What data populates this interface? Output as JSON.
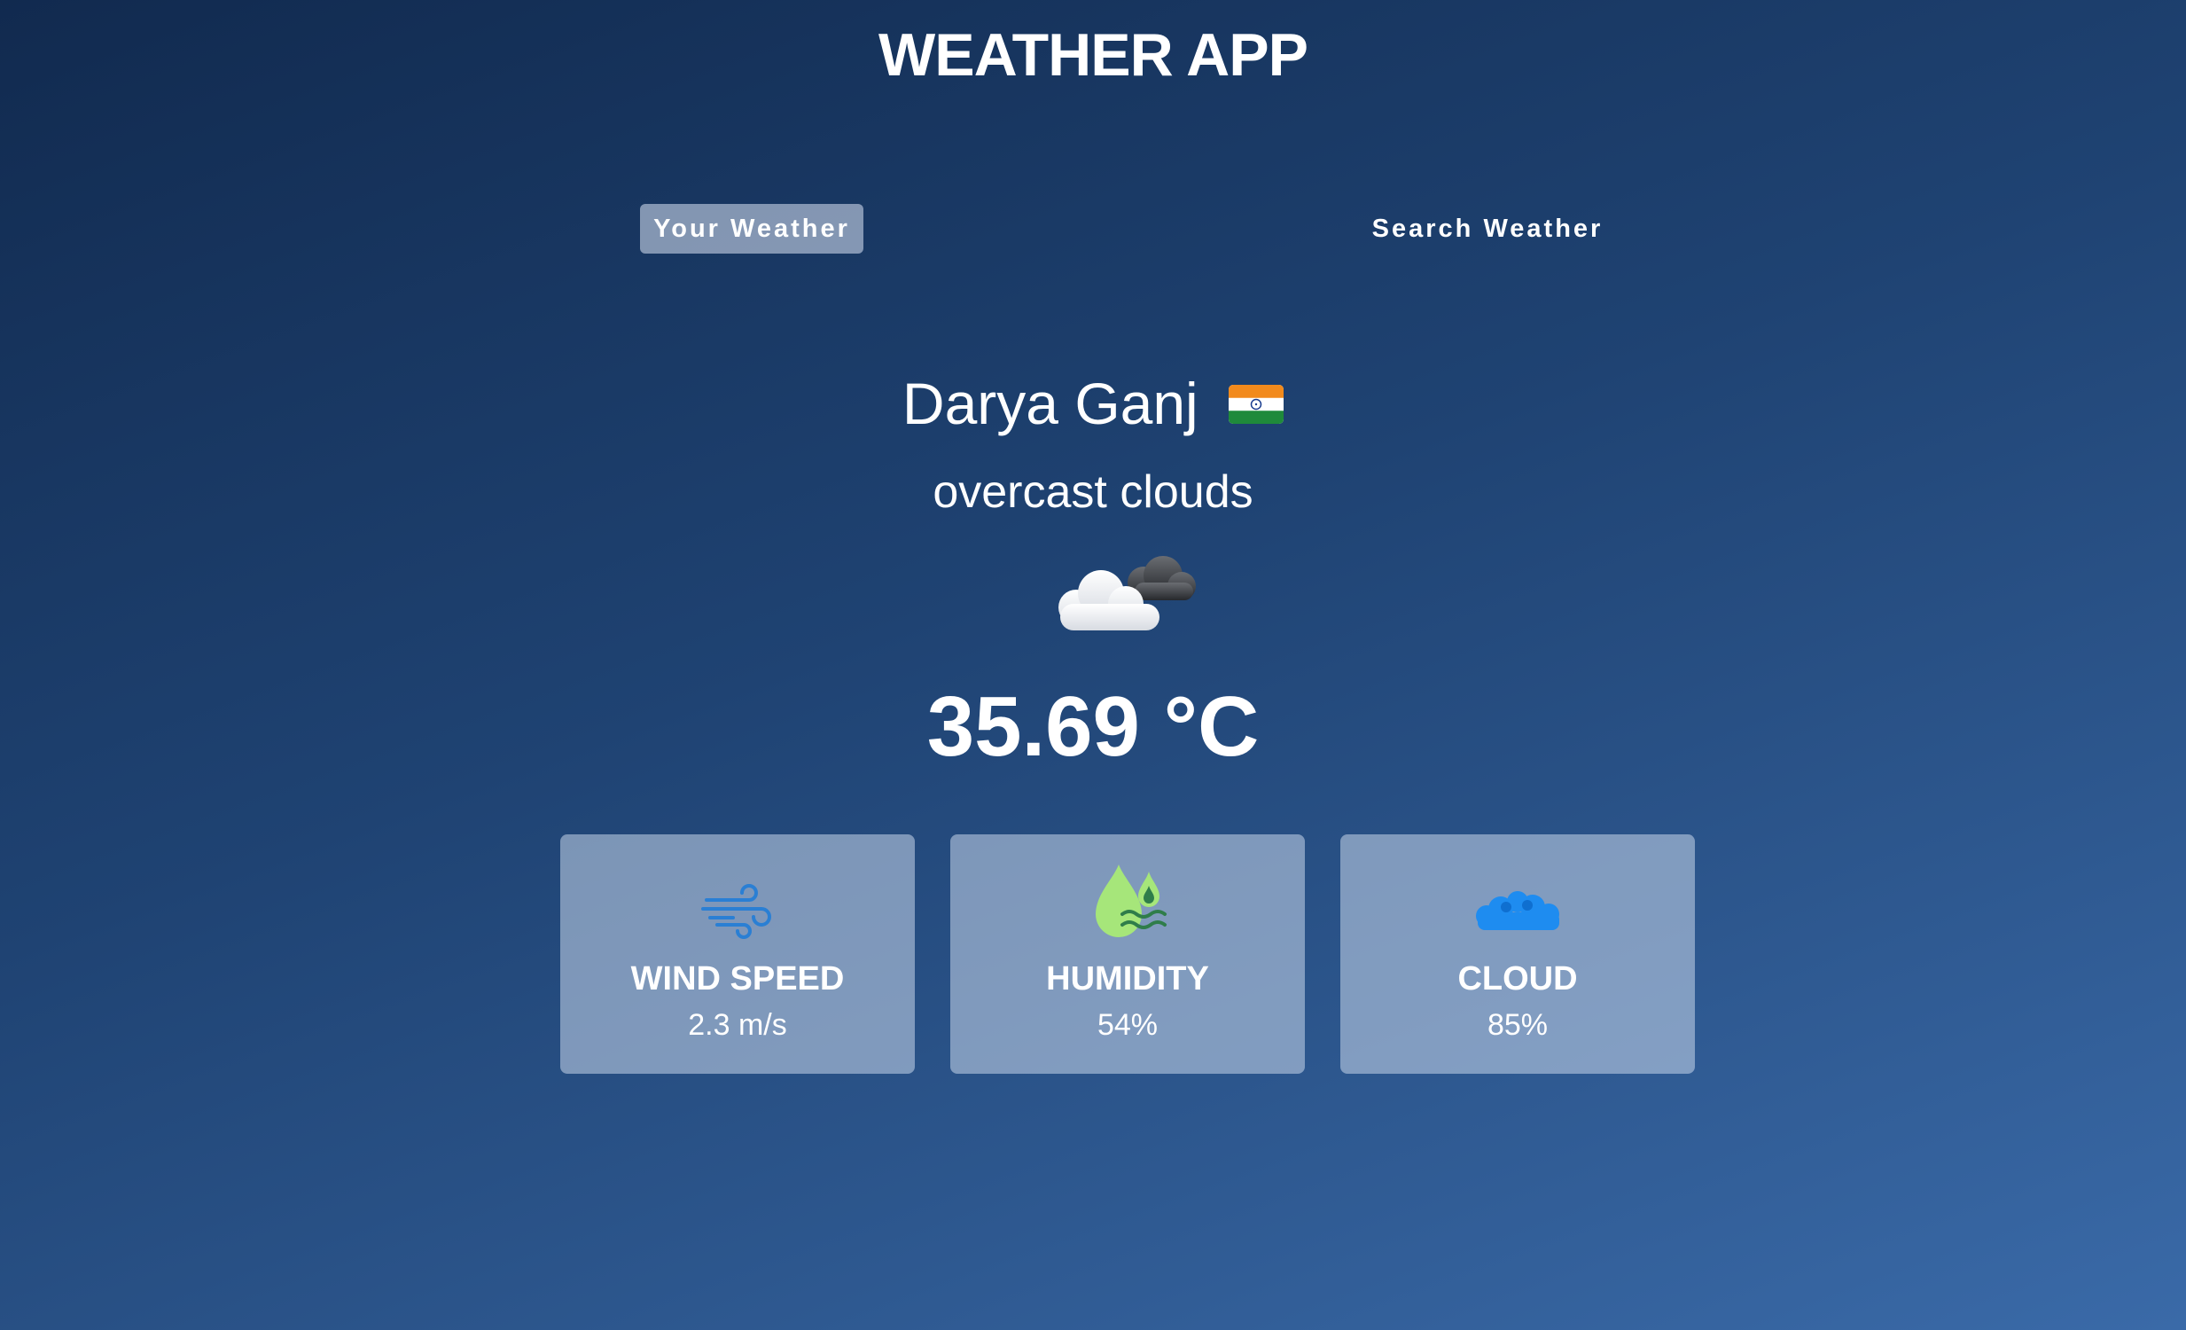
{
  "app": {
    "title": "WEATHER APP"
  },
  "tabs": [
    {
      "label": "Your Weather",
      "active": true
    },
    {
      "label": "Search Weather",
      "active": false
    }
  ],
  "location": {
    "city": "Darya Ganj",
    "country_flag_icon": "india-flag-icon"
  },
  "weather": {
    "description": "overcast clouds",
    "icon": "overcast-clouds-icon",
    "temperature": "35.69 °C"
  },
  "stats": [
    {
      "label": "WIND SPEED",
      "value": "2.3 m/s",
      "icon": "wind-icon",
      "icon_color": "#2a7fd4"
    },
    {
      "label": "HUMIDITY",
      "value": "54%",
      "icon": "humidity-drops-icon",
      "icon_color": "#a6e67a"
    },
    {
      "label": "CLOUD",
      "value": "85%",
      "icon": "cloud-icon",
      "icon_color": "#1e8cf0"
    }
  ],
  "colors": {
    "background_top": "#112a4f",
    "background_bottom": "#3a6aa8",
    "card_background": "rgba(200,215,235,0.55)",
    "text": "#ffffff"
  }
}
